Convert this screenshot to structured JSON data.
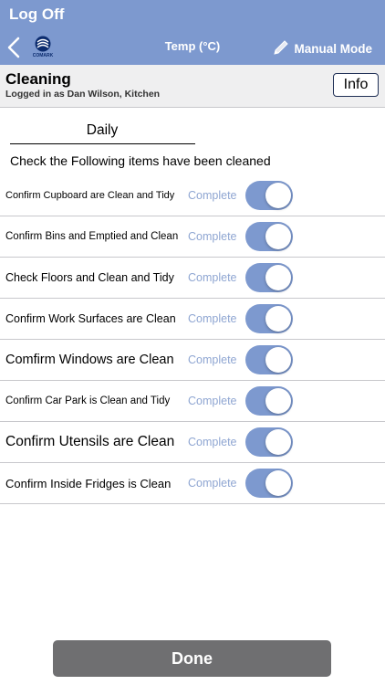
{
  "header": {
    "logoff_label": "Log Off",
    "nav_title": "Temp (°C)",
    "manual_mode_label": "Manual Mode",
    "logo_text": "COMARK",
    "bar_color": "#7d99cf"
  },
  "subheader": {
    "title": "Cleaning",
    "logged_in": "Logged in as Dan Wilson, Kitchen",
    "info_label": "Info"
  },
  "checklist": {
    "frequency": "Daily",
    "instructions": "Check the Following items have been cleaned",
    "items": [
      {
        "label": "Confirm Cupboard are Clean and Tidy",
        "status": "Complete",
        "checked": true
      },
      {
        "label": "Confirm Bins and Emptied and Clean",
        "status": "Complete",
        "checked": true
      },
      {
        "label": "Check Floors and Clean and Tidy",
        "status": "Complete",
        "checked": true
      },
      {
        "label": "Confirm Work Surfaces are Clean",
        "status": "Complete",
        "checked": true
      },
      {
        "label": "Comfirm Windows are Clean",
        "status": "Complete",
        "checked": true
      },
      {
        "label": "Confirm Car Park is Clean and Tidy",
        "status": "Complete",
        "checked": true
      },
      {
        "label": "Confirm Utensils are Clean",
        "status": "Complete",
        "checked": true
      },
      {
        "label": "Confirm Inside Fridges is Clean",
        "status": "Complete",
        "checked": true
      }
    ]
  },
  "footer": {
    "done_label": "Done"
  }
}
